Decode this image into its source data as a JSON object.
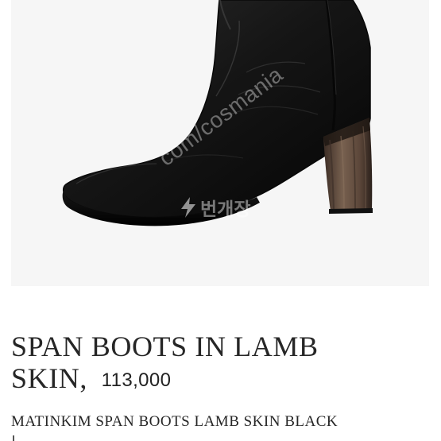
{
  "product": {
    "image": {
      "alt": "Black leather span boots with block heel",
      "watermark": "com/cosmania",
      "brand_watermark": "번개장"
    },
    "title": "SPAN BOOTS IN LAMB SKIN,",
    "price": "113,000",
    "subtitle": "MATINKIM SPAN BOOTS LAMB SKIN BLACK"
  },
  "colors": {
    "background": "#ffffff",
    "image_background": "#f6f6f6",
    "text": "#262626",
    "boot": "#111111",
    "heel": "#5a4639"
  },
  "icons": {
    "brand_logo": "bolt-icon"
  }
}
